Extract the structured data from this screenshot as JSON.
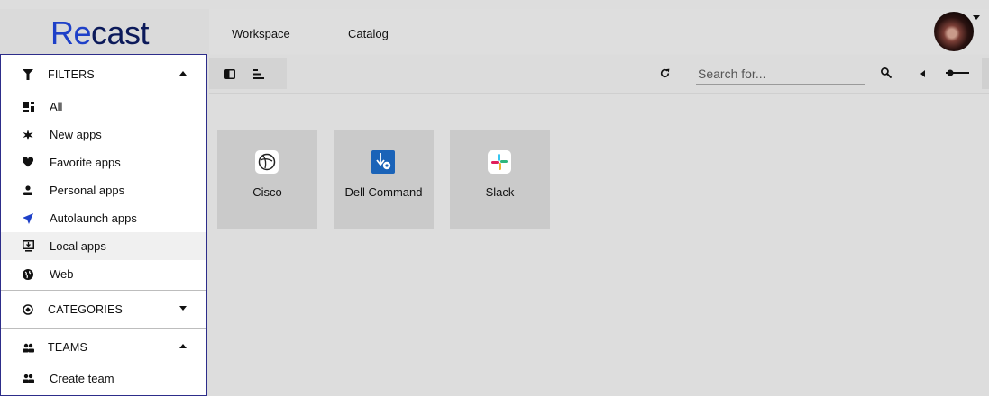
{
  "brand": {
    "logo_part1": "Re",
    "logo_part2": "cast"
  },
  "nav": {
    "workspace": "Workspace",
    "catalog": "Catalog"
  },
  "toolbar": {
    "search_placeholder": "Search for..."
  },
  "sidebar": {
    "filters": {
      "header": "FILTERS",
      "items": [
        {
          "label": "All",
          "icon": "grid-icon"
        },
        {
          "label": "New apps",
          "icon": "star-icon"
        },
        {
          "label": "Favorite apps",
          "icon": "heart-icon"
        },
        {
          "label": "Personal apps",
          "icon": "person-icon"
        },
        {
          "label": "Autolaunch apps",
          "icon": "send-icon"
        },
        {
          "label": "Local apps",
          "icon": "monitor-download-icon",
          "selected": true
        },
        {
          "label": "Web",
          "icon": "globe-icon"
        }
      ]
    },
    "categories": {
      "header": "CATEGORIES"
    },
    "teams": {
      "header": "TEAMS",
      "items": [
        {
          "label": "Create team",
          "icon": "users-icon"
        }
      ]
    }
  },
  "apps": [
    {
      "label": "Cisco",
      "icon": "cisco-icon"
    },
    {
      "label": "Dell Command",
      "icon": "dell-command-icon"
    },
    {
      "label": "Slack",
      "icon": "slack-icon"
    }
  ],
  "colors": {
    "brand_blue": "#1e40c8",
    "brand_navy": "#0c1a5a",
    "sidebar_border": "#2d2d8a",
    "dell_blue": "#1a63b8"
  }
}
